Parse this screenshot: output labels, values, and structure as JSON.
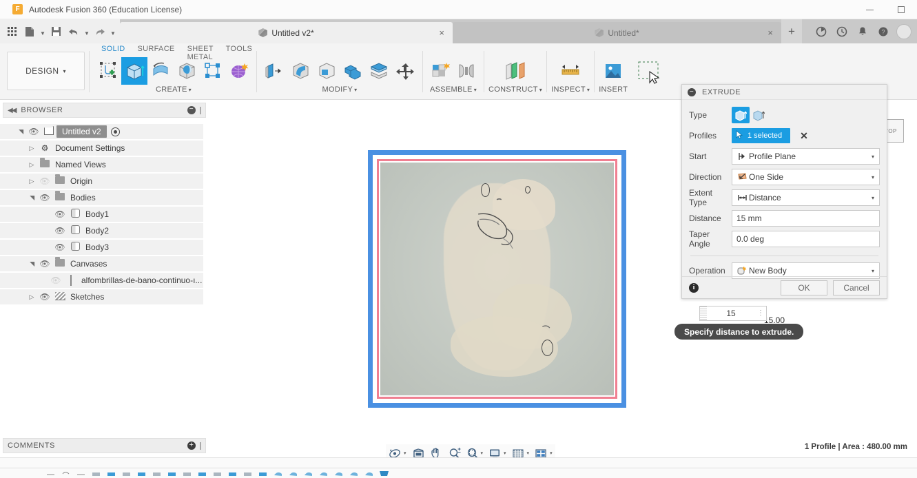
{
  "window": {
    "app_title": "Autodesk Fusion 360 (Education License)",
    "logo_letter": "F",
    "minimize_label": "Minimize",
    "maximize_label": "Maximize"
  },
  "quick_access": {
    "buttons": [
      {
        "name": "app-grid-icon",
        "label": "Show Data Panel"
      },
      {
        "name": "file-icon",
        "label": "File"
      },
      {
        "name": "save-icon",
        "label": "Save"
      },
      {
        "name": "undo-icon",
        "label": "Undo"
      },
      {
        "name": "redo-icon",
        "label": "Redo"
      }
    ],
    "tabs": [
      {
        "title": "Untitled v2*",
        "active": true,
        "close": "×"
      },
      {
        "title": "Untitled*",
        "active": false,
        "close": "×"
      }
    ],
    "new_tab": "+",
    "right_icons": [
      {
        "name": "job-status-icon",
        "glyph": "◔"
      },
      {
        "name": "recent-icon",
        "glyph": "◴"
      },
      {
        "name": "notifications-bell-icon",
        "glyph": "⌂"
      },
      {
        "name": "help-icon",
        "glyph": "?"
      },
      {
        "name": "account-avatar",
        "glyph": ""
      }
    ]
  },
  "ribbon": {
    "workspace": "DESIGN",
    "workspace_caret": "▾",
    "tabs": [
      {
        "label": "SOLID",
        "active": true
      },
      {
        "label": "SURFACE",
        "active": false
      },
      {
        "label": "SHEET METAL",
        "active": false
      },
      {
        "label": "TOOLS",
        "active": false
      }
    ],
    "panels": [
      {
        "label": "CREATE",
        "caret": "▾"
      },
      {
        "label": "MODIFY",
        "caret": "▾"
      },
      {
        "label": "ASSEMBLE",
        "caret": "▾"
      },
      {
        "label": "CONSTRUCT",
        "caret": "▾"
      },
      {
        "label": "INSPECT",
        "caret": "▾"
      },
      {
        "label": "INSERT",
        "caret": ""
      }
    ],
    "tools": {
      "create_sketch": "create-sketch-icon",
      "extrude": "extrude-icon",
      "revolve": "revolve-icon",
      "sphere": "sphere-icon",
      "pattern": "pattern-icon",
      "form": "create-form-icon",
      "press_pull": "press-pull-icon",
      "fillet": "fillet-icon",
      "shell": "shell-icon",
      "combine": "combine-icon",
      "split_face": "split-face-icon",
      "move_copy": "move-copy-icon",
      "new_component": "new-component-icon",
      "joint": "joint-icon",
      "offset_plane": "offset-plane-icon",
      "measure": "measure-icon",
      "insert_canvas": "insert-canvas-icon",
      "selected_tool": "selection-marquee-icon"
    }
  },
  "browser": {
    "title": "BROWSER",
    "collapse_glyph": "◀◀",
    "minus_glyph": "−",
    "tree": [
      {
        "label": "Untitled v2",
        "indent": 0,
        "arrow": "open",
        "eye": "on",
        "icon": "component-icon",
        "selected": true,
        "has_target": true
      },
      {
        "label": "Document Settings",
        "indent": 1,
        "arrow": "closed",
        "eye": "none",
        "icon": "gear-icon",
        "selected": false,
        "has_target": false
      },
      {
        "label": "Named Views",
        "indent": 1,
        "arrow": "closed",
        "eye": "none",
        "icon": "folder-icon",
        "selected": false,
        "has_target": false
      },
      {
        "label": "Origin",
        "indent": 1,
        "arrow": "closed",
        "eye": "off",
        "icon": "folder-icon",
        "selected": false,
        "has_target": false
      },
      {
        "label": "Bodies",
        "indent": 1,
        "arrow": "open",
        "eye": "on",
        "icon": "folder-icon",
        "selected": false,
        "has_target": false
      },
      {
        "label": "Body1",
        "indent": 2,
        "arrow": "none",
        "eye": "on",
        "icon": "body-icon",
        "selected": false,
        "has_target": false
      },
      {
        "label": "Body2",
        "indent": 2,
        "arrow": "none",
        "eye": "on",
        "icon": "body-icon",
        "selected": false,
        "has_target": false
      },
      {
        "label": "Body3",
        "indent": 2,
        "arrow": "none",
        "eye": "on",
        "icon": "body-icon",
        "selected": false,
        "has_target": false
      },
      {
        "label": "Canvases",
        "indent": 1,
        "arrow": "open",
        "eye": "on",
        "icon": "folder-icon",
        "selected": false,
        "has_target": false
      },
      {
        "label": "alfombrillas-de-bano-continuo-ı...",
        "indent": 2,
        "arrow": "none",
        "eye": "off",
        "icon": "canvas-thumb-icon",
        "selected": false,
        "has_target": false
      },
      {
        "label": "Sketches",
        "indent": 1,
        "arrow": "closed",
        "eye": "on",
        "icon": "sketch-icon",
        "selected": false,
        "has_target": false
      }
    ]
  },
  "comments": {
    "title": "COMMENTS",
    "add_glyph": "+"
  },
  "canvas": {
    "dimension_label": "15.00",
    "viewcube_face": "TOP"
  },
  "extrude_dialog": {
    "title": "EXTRUDE",
    "minimize_glyph": "−",
    "rows": {
      "type_label": "Type",
      "profiles_label": "Profiles",
      "profiles_value": "1 selected",
      "profiles_clear": "✕",
      "start_label": "Start",
      "start_value": "Profile Plane",
      "direction_label": "Direction",
      "direction_value": "One Side",
      "extent_type_label": "Extent Type",
      "extent_type_value": "Distance",
      "distance_label": "Distance",
      "distance_value": "15 mm",
      "taper_label": "Taper Angle",
      "taper_value": "0.0 deg",
      "operation_label": "Operation",
      "operation_value": "New Body"
    },
    "caret": "▾",
    "info_glyph": "i",
    "ok_label": "OK",
    "cancel_label": "Cancel"
  },
  "manipulator": {
    "value": "15",
    "tooltip": "Specify distance to extrude."
  },
  "navbar": {
    "items": [
      {
        "name": "orbit-icon",
        "caret": "▾"
      },
      {
        "name": "look-at-icon",
        "caret": ""
      },
      {
        "name": "pan-hand-icon",
        "caret": ""
      },
      {
        "name": "zoom-icon",
        "caret": ""
      },
      {
        "name": "zoom-window-icon",
        "caret": "▾"
      },
      {
        "name": "display-settings-icon",
        "caret": "▾"
      },
      {
        "name": "grid-snap-icon",
        "caret": "▾"
      },
      {
        "name": "viewport-layout-icon",
        "caret": "▾"
      }
    ]
  },
  "status": {
    "text": "1 Profile | Area : 480.00 mm"
  },
  "colors": {
    "accent_blue": "#1b9de2",
    "tab_active_blue": "#2b8ccc",
    "selection_blue": "#4a90e2",
    "sketch_pink": "#f07f91",
    "panel_bg": "#f4f4f4",
    "titlebar_bg": "#c9c9c9"
  }
}
